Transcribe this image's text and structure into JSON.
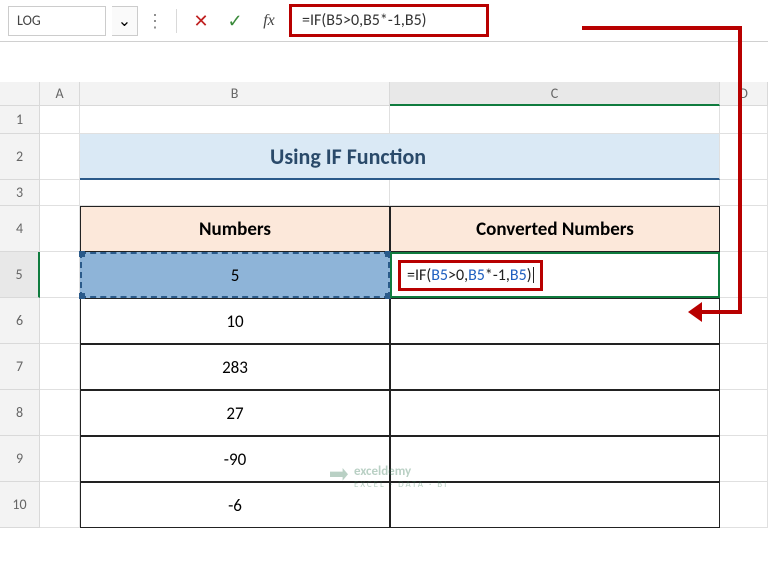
{
  "namebox": {
    "value": "LOG"
  },
  "formula_bar": {
    "text": "=IF(B5>0,B5*-1,B5)"
  },
  "columns": {
    "A": "A",
    "B": "B",
    "C": "C",
    "D": "D"
  },
  "rows": [
    "1",
    "2",
    "3",
    "4",
    "5",
    "6",
    "7",
    "8",
    "9",
    "10"
  ],
  "title": "Using IF Function",
  "headers": {
    "numbers": "Numbers",
    "converted": "Converted Numbers"
  },
  "data": {
    "b5": "5",
    "b6": "10",
    "b7": "283",
    "b8": "27",
    "b9": "-90",
    "b10": "-6"
  },
  "c5_formula": {
    "p1": "=IF(",
    "ref1": "B5",
    "p2": ">0,",
    "ref2": "B5",
    "p3": "*-1,",
    "ref3": "B5",
    "p4": ")"
  },
  "watermark": {
    "brand": "exceldemy",
    "sub": "EXCEL · DATA · BI"
  },
  "icons": {
    "chevron": "⌄",
    "cancel": "✕",
    "enter": "✓",
    "fx": "fx"
  }
}
